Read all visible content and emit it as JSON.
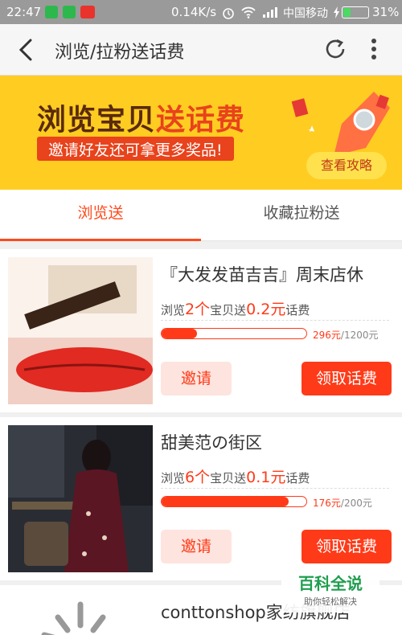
{
  "status_bar": {
    "time": "22:47",
    "speed": "0.14K/s",
    "carrier": "中国移动",
    "battery": "31%"
  },
  "toolbar": {
    "title": "浏览/拉粉送话费"
  },
  "banner": {
    "headline_a": "浏览宝贝",
    "headline_b": "送话费",
    "subtitle": "邀请好友还可拿更多奖品!",
    "guide_button": "查看攻略"
  },
  "tabs": [
    {
      "label": "浏览送",
      "active": true
    },
    {
      "label": "收藏拉粉送",
      "active": false
    }
  ],
  "items": [
    {
      "shop": "『大发发苗吉吉』周末店休",
      "prefix": "浏览",
      "count": "2个",
      "mid": "宝贝送",
      "amount": "0.2元",
      "suffix": "话费",
      "progress_value": "296元",
      "progress_total": "/1200元",
      "progress_fraction": 0.247,
      "invite_label": "邀请",
      "claim_label": "领取话费"
    },
    {
      "shop": "甜美范の街区",
      "prefix": "浏览",
      "count": "6个",
      "mid": "宝贝送",
      "amount": "0.1元",
      "suffix": "话费",
      "progress_value": "176元",
      "progress_total": "/200元",
      "progress_fraction": 0.88,
      "invite_label": "邀请",
      "claim_label": "领取话费"
    },
    {
      "shop": "conttonshop家纺旗舰店"
    }
  ],
  "watermark": {
    "title": "百科全说",
    "subtitle": "助你轻松解决"
  },
  "colors": {
    "accent": "#ff3a18",
    "banner": "#ffcc22"
  }
}
